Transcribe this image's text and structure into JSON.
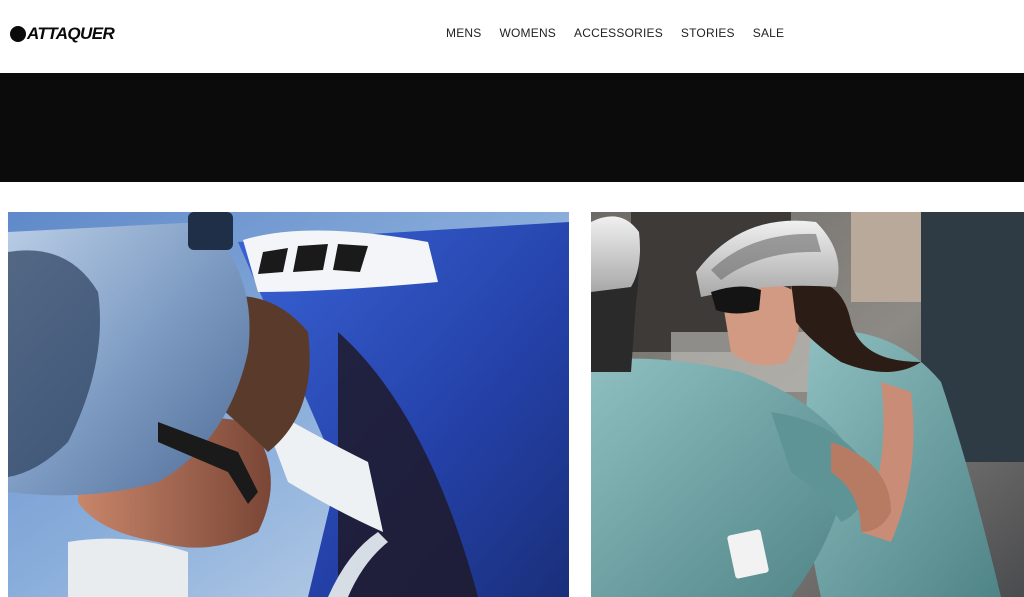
{
  "brand": {
    "name": "ATTAQUER"
  },
  "nav": {
    "items": [
      {
        "label": "MENS"
      },
      {
        "label": "WOMENS"
      },
      {
        "label": "ACCESSORIES"
      },
      {
        "label": "STORIES"
      },
      {
        "label": "SALE"
      }
    ]
  },
  "colors": {
    "banner": "#0b0b0b",
    "text": "#222222",
    "sky": "#9fbad9",
    "jersey_blue": "#2f55c9",
    "jersey_teal": "#6fa3a6"
  },
  "images": [
    {
      "name": "cyclist-white-helmet-blue-jersey",
      "icon": "photo"
    },
    {
      "name": "two-cyclists-teal-jerseys",
      "icon": "photo"
    }
  ]
}
